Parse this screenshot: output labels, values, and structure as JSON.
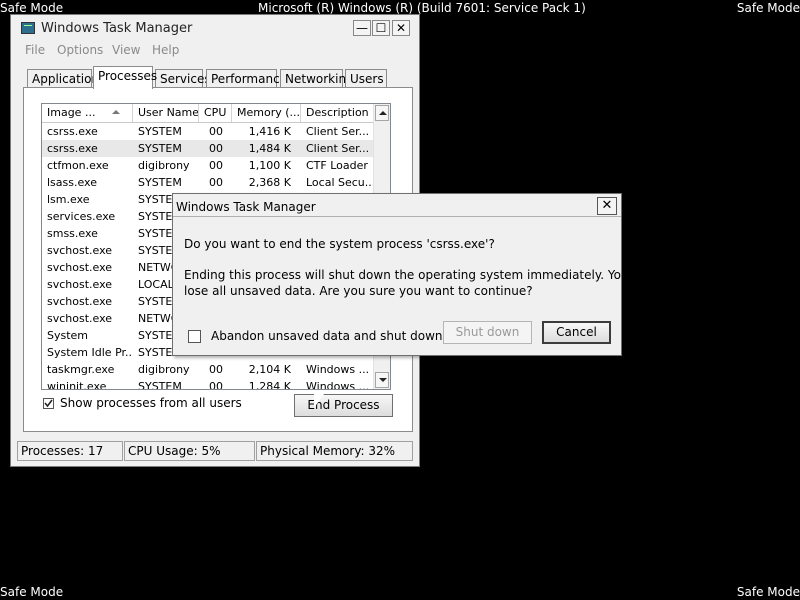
{
  "desktop": {
    "safe_mode_tl": "Safe Mode",
    "safe_mode_tr": "Safe Mode",
    "safe_mode_bl": "Safe Mode",
    "safe_mode_br": "Safe Mode",
    "os_banner": "Microsoft (R) Windows (R) (Build 7601: Service Pack 1)"
  },
  "task_manager": {
    "title": "Windows Task Manager",
    "window_controls": {
      "minimize": "—",
      "maximize": "☐",
      "close": "✕"
    },
    "menu": [
      "File",
      "Options",
      "View",
      "Help"
    ],
    "tabs": [
      "Applications",
      "Processes",
      "Services",
      "Performance",
      "Networking",
      "Users"
    ],
    "active_tab": "Processes",
    "columns": [
      "Image ...",
      "User Name",
      "CPU",
      "Memory (...",
      "Description"
    ],
    "processes": [
      {
        "image": "csrss.exe",
        "user": "SYSTEM",
        "cpu": "00",
        "memory": "1,416 K",
        "description": "Client Ser..."
      },
      {
        "image": "csrss.exe",
        "user": "SYSTEM",
        "cpu": "00",
        "memory": "1,484 K",
        "description": "Client Ser..."
      },
      {
        "image": "ctfmon.exe",
        "user": "digibrony",
        "cpu": "00",
        "memory": "1,100 K",
        "description": "CTF Loader"
      },
      {
        "image": "lsass.exe",
        "user": "SYSTEM",
        "cpu": "00",
        "memory": "2,368 K",
        "description": "Local Secu..."
      },
      {
        "image": "lsm.exe",
        "user": "SYSTEM",
        "cpu": "",
        "memory": "",
        "description": ""
      },
      {
        "image": "services.exe",
        "user": "SYSTEM",
        "cpu": "",
        "memory": "",
        "description": ""
      },
      {
        "image": "smss.exe",
        "user": "SYSTEM",
        "cpu": "",
        "memory": "",
        "description": ""
      },
      {
        "image": "svchost.exe",
        "user": "SYSTEM",
        "cpu": "",
        "memory": "",
        "description": ""
      },
      {
        "image": "svchost.exe",
        "user": "NETWO",
        "cpu": "",
        "memory": "",
        "description": ""
      },
      {
        "image": "svchost.exe",
        "user": "LOCAL",
        "cpu": "",
        "memory": "",
        "description": ""
      },
      {
        "image": "svchost.exe",
        "user": "SYSTEM",
        "cpu": "",
        "memory": "",
        "description": ""
      },
      {
        "image": "svchost.exe",
        "user": "NETWO",
        "cpu": "",
        "memory": "",
        "description": ""
      },
      {
        "image": "System",
        "user": "SYSTEM",
        "cpu": "",
        "memory": "",
        "description": ""
      },
      {
        "image": "System Idle Pr...",
        "user": "SYSTEM",
        "cpu": "",
        "memory": "",
        "description": ""
      },
      {
        "image": "taskmgr.exe",
        "user": "digibrony",
        "cpu": "00",
        "memory": "2,104 K",
        "description": "Windows ..."
      },
      {
        "image": "wininit.exe",
        "user": "SYSTEM",
        "cpu": "00",
        "memory": "1,284 K",
        "description": "Windows ..."
      }
    ],
    "selected_row": 1,
    "show_all_label": "Show processes from all users",
    "show_all_checked": true,
    "end_process_label": "End Process",
    "status": {
      "processes": "Processes: 17",
      "cpu": "CPU Usage: 5%",
      "memory": "Physical Memory: 32%"
    }
  },
  "dialog": {
    "title": "Windows Task Manager",
    "close": "✕",
    "question": "Do you want to end the system process 'csrss.exe'?",
    "warning_line1": "Ending this process will shut down the operating system immediately.  You will",
    "warning_line2": "lose all unsaved data.  Are you sure you want to continue?",
    "abandon_label": "Abandon unsaved data and shut down.",
    "abandon_checked": false,
    "shutdown_label": "Shut down",
    "shutdown_enabled": false,
    "cancel_label": "Cancel"
  }
}
